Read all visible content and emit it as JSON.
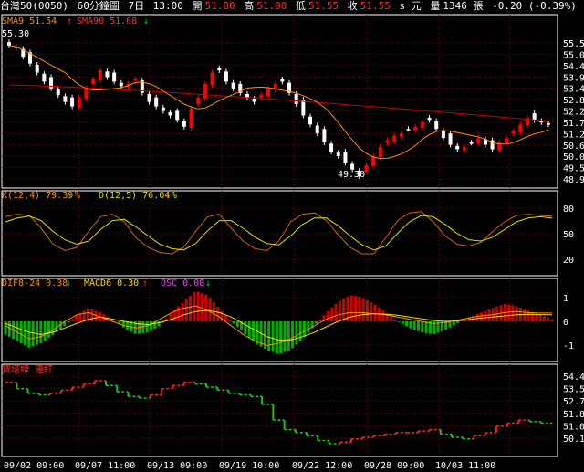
{
  "header": {
    "symbol": "台灣50(0050)",
    "interval": "60分鐘圖",
    "date": "7日",
    "time": "13:00",
    "open_label": "開",
    "open": "51.80",
    "high_label": "高",
    "high": "51.90",
    "low_label": "低",
    "low": "51.55",
    "close_label": "收",
    "close": "51.55",
    "unit": "s 元",
    "volume_label": "量",
    "volume": "1346 張",
    "change": "-0.20 (-0.39%)"
  },
  "colors": {
    "up": "#ff0000",
    "down": "#ffffff",
    "sma9": "#ff8c00",
    "sma90": "#cc0000",
    "k": "#cc6600",
    "d": "#dddd00",
    "dif": "#ff8c00",
    "macd": "#ffd700",
    "osc_pos": "#cc0000",
    "osc_neg": "#00b000",
    "grid": "#7a0000",
    "axis": "#ffffff"
  },
  "price_panel": {
    "sma9_label": "SMA9 51.54",
    "sma9_arrow": "↑",
    "sma90_label": "SMA90 51.68",
    "sma90_arrow": "↓",
    "high_mark": "55.30",
    "low_mark": "49.30",
    "yticks": [
      "55.5",
      "55.0",
      "54.4",
      "53.9",
      "53.4",
      "52.8",
      "52.2",
      "51.7",
      "51.2",
      "50.6",
      "50.0",
      "49.5",
      "48.9"
    ]
  },
  "kd_panel": {
    "k_label": "K(12,4) 79.39",
    "k_arrow": "↓",
    "k_pct": "%",
    "d_label": "D(12,5) 76.04",
    "d_arrow": "↑",
    "d_pct": "%",
    "yticks": [
      "80",
      "50",
      "20"
    ]
  },
  "macd_panel": {
    "dif_label": "DIF8-24 0.38",
    "dif_arrow": "↓",
    "macd_label": "MACD6 0.30",
    "macd_arrow": "↑",
    "osc_label": "OSC 0.08",
    "osc_arrow": "↓",
    "yticks": [
      "1",
      "0",
      "-1"
    ]
  },
  "trend_panel": {
    "label": "寶塔線 連紅",
    "yticks": [
      "54.4",
      "53.5",
      "52.7",
      "51.8",
      "51.0",
      "50.1"
    ]
  },
  "x_axis": {
    "ticks": [
      "09/02 09:00",
      "09/07 11:00",
      "09/13 09:00",
      "09/19 10:00",
      "09/22 12:00",
      "09/28 09:00",
      "10/03 11:00"
    ]
  },
  "chart_data": {
    "type": "candlestick",
    "title": "台灣50(0050) 60分鐘圖",
    "ylim": [
      48.9,
      55.5
    ],
    "series": [
      {
        "name": "SMA9",
        "role": "line"
      },
      {
        "name": "SMA90",
        "role": "line"
      }
    ],
    "close_path": [
      55.1,
      55.0,
      54.6,
      54.3,
      53.9,
      53.5,
      53.2,
      52.9,
      52.6,
      52.4,
      52.8,
      53.2,
      53.6,
      54.0,
      53.7,
      53.5,
      53.3,
      53.4,
      53.6,
      53.0,
      52.6,
      52.4,
      52.2,
      52.0,
      51.8,
      51.5,
      52.3,
      52.8,
      53.4,
      53.9,
      54.0,
      53.5,
      53.2,
      53.0,
      52.8,
      52.6,
      52.9,
      53.2,
      53.4,
      53.5,
      53.0,
      52.5,
      52.0,
      51.6,
      51.2,
      50.8,
      50.4,
      50.2,
      49.9,
      49.6,
      49.3,
      49.8,
      50.2,
      50.6,
      50.9,
      51.1,
      51.2,
      51.4,
      51.5,
      51.7,
      51.8,
      51.4,
      51.0,
      50.7,
      50.5,
      50.6,
      50.8,
      51.0,
      50.7,
      50.5,
      50.8,
      51.0,
      51.3,
      51.6,
      51.9,
      51.8,
      51.7,
      51.6
    ],
    "kd": {
      "k_values": [
        78,
        82,
        80,
        60,
        35,
        25,
        30,
        55,
        78,
        82,
        70,
        45,
        30,
        22,
        20,
        30,
        55,
        78,
        82,
        60,
        40,
        28,
        25,
        40,
        70,
        82,
        84,
        72,
        50,
        30,
        20,
        20,
        45,
        72,
        84,
        86,
        70,
        48,
        35,
        32,
        38,
        55,
        70,
        80,
        82,
        80,
        79
      ],
      "d_values": [
        70,
        76,
        79,
        72,
        55,
        42,
        35,
        40,
        58,
        72,
        74,
        62,
        48,
        35,
        28,
        26,
        36,
        56,
        72,
        72,
        60,
        46,
        36,
        34,
        48,
        66,
        76,
        76,
        64,
        48,
        34,
        26,
        32,
        52,
        70,
        80,
        78,
        66,
        52,
        42,
        40,
        46,
        58,
        70,
        76,
        78,
        76
      ],
      "ylim": [
        0,
        100
      ]
    },
    "macd": {
      "osc": [
        -0.6,
        -0.9,
        -1.2,
        -1.0,
        -0.6,
        -0.2,
        0.3,
        0.6,
        0.4,
        0.1,
        -0.3,
        -0.6,
        -0.5,
        -0.2,
        0.4,
        0.9,
        1.4,
        1.2,
        0.6,
        0.0,
        -0.5,
        -1.0,
        -1.3,
        -1.5,
        -1.3,
        -0.8,
        -0.2,
        0.4,
        0.9,
        1.2,
        1.1,
        0.8,
        0.4,
        0.0,
        -0.3,
        -0.5,
        -0.6,
        -0.4,
        -0.1,
        0.2,
        0.4,
        0.6,
        0.8,
        0.7,
        0.5,
        0.3,
        0.1
      ],
      "dif": [
        -0.2,
        -0.5,
        -0.8,
        -0.7,
        -0.4,
        0.0,
        0.3,
        0.4,
        0.2,
        0.0,
        -0.2,
        -0.3,
        -0.2,
        0.1,
        0.4,
        0.6,
        0.7,
        0.5,
        0.2,
        -0.2,
        -0.6,
        -0.9,
        -1.1,
        -1.0,
        -0.8,
        -0.5,
        -0.2,
        0.1,
        0.3,
        0.4,
        0.4,
        0.35,
        0.3,
        0.2,
        0.1,
        0.0,
        -0.1,
        -0.05,
        0.05,
        0.15,
        0.25,
        0.3,
        0.4,
        0.45,
        0.4,
        0.38,
        0.38
      ],
      "macd": [
        -0.1,
        -0.3,
        -0.5,
        -0.6,
        -0.5,
        -0.3,
        -0.1,
        0.1,
        0.2,
        0.1,
        0.0,
        -0.1,
        -0.15,
        -0.05,
        0.1,
        0.3,
        0.45,
        0.5,
        0.4,
        0.2,
        -0.1,
        -0.4,
        -0.7,
        -0.85,
        -0.85,
        -0.7,
        -0.5,
        -0.25,
        0.0,
        0.2,
        0.3,
        0.35,
        0.33,
        0.28,
        0.2,
        0.12,
        0.04,
        0.0,
        0.02,
        0.08,
        0.15,
        0.2,
        0.25,
        0.3,
        0.32,
        0.31,
        0.3
      ],
      "ylim": [
        -1.5,
        1.5
      ]
    },
    "tower": {
      "values": [
        54.2,
        53.8,
        53.5,
        53.4,
        53.5,
        53.7,
        53.9,
        54.1,
        54.3,
        54.0,
        53.6,
        53.3,
        53.2,
        53.4,
        53.8,
        54.0,
        54.2,
        54.1,
        53.9,
        53.7,
        53.5,
        53.4,
        53.3,
        52.8,
        51.8,
        51.2,
        51.0,
        50.8,
        50.5,
        50.3,
        50.4,
        50.6,
        50.7,
        50.8,
        50.9,
        51.0,
        51.0,
        51.1,
        51.2,
        50.9,
        50.7,
        50.6,
        50.8,
        51.0,
        51.4,
        51.6,
        51.8,
        51.7,
        51.6
      ],
      "ylim": [
        49.6,
        55.0
      ]
    }
  }
}
